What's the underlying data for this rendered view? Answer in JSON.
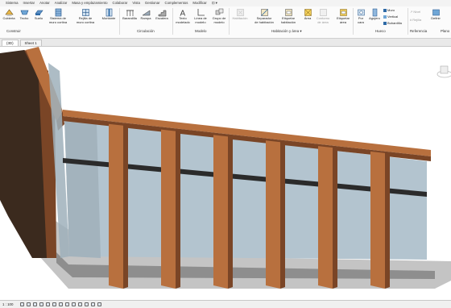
{
  "ribbon": {
    "tabs": [
      "Sistema",
      "Insertar",
      "Anotar",
      "Analizar",
      "Masa y emplazamiento",
      "Colaborar",
      "Vista",
      "Gestionar",
      "Complementos",
      "Modificar",
      "⊡ ▾"
    ],
    "tools": [
      {
        "label": "Cubierta",
        "icon": "roof-icon"
      },
      {
        "label": "Techo",
        "icon": "ceiling-icon"
      },
      {
        "label": "Suelo",
        "icon": "floor-icon"
      },
      {
        "label": "Sistema de\nmuro cortina",
        "icon": "curtain-system-icon"
      },
      {
        "label": "Rejilla de\nmuro cortina",
        "icon": "curtain-grid-icon"
      },
      {
        "label": "Montante",
        "icon": "mullion-icon"
      },
      {
        "label": "Barandilla",
        "icon": "railing-icon"
      },
      {
        "label": "Rampa",
        "icon": "ramp-icon"
      },
      {
        "label": "Escalera",
        "icon": "stair-icon"
      },
      {
        "label": "Texto\nmodelado",
        "icon": "model-text-icon"
      },
      {
        "label": "Línea de\nmodelo",
        "icon": "model-line-icon"
      },
      {
        "label": "Grupo de\nmodelo",
        "icon": "model-group-icon"
      },
      {
        "label": "Habitación",
        "icon": "room-icon",
        "disabled": true
      },
      {
        "label": "Separador\nde habitación",
        "icon": "room-separator-icon"
      },
      {
        "label": "Etiquetar\nhabitación",
        "icon": "tag-room-icon"
      },
      {
        "label": "Área",
        "icon": "area-icon"
      },
      {
        "label": "Contorno\nde área",
        "icon": "area-boundary-icon",
        "disabled": true
      },
      {
        "label": "Etiquetar\nárea",
        "icon": "tag-area-icon"
      },
      {
        "label": "Por\ncara",
        "icon": "by-face-icon"
      },
      {
        "label": "Agujero",
        "icon": "shaft-icon"
      },
      {
        "label": "Definir",
        "icon": "set-icon"
      }
    ],
    "small_tools": [
      {
        "label": "Muro",
        "icon": "wall-opening-icon"
      },
      {
        "label": "Vertical",
        "icon": "vertical-opening-icon"
      },
      {
        "label": "Buhardilla",
        "icon": "dormer-icon"
      },
      {
        "label": "Nivel",
        "icon": "level-icon",
        "disabled": true
      },
      {
        "label": "Rejilla",
        "icon": "grid-icon",
        "disabled": true
      }
    ],
    "groups": [
      "Construir",
      "Circulación",
      "Modelo",
      "Habitación y área ▾",
      "Hueco",
      "Referencia",
      "Plano"
    ]
  },
  "doc_tabs": [
    "(3D)",
    "Sheet 1"
  ],
  "status": {
    "scale": "1 : 100"
  },
  "colors": {
    "wood": "#b8703e",
    "wood_dark": "#7a4526",
    "glass": "#b3c4cf",
    "shadow": "#8c8c8c"
  }
}
